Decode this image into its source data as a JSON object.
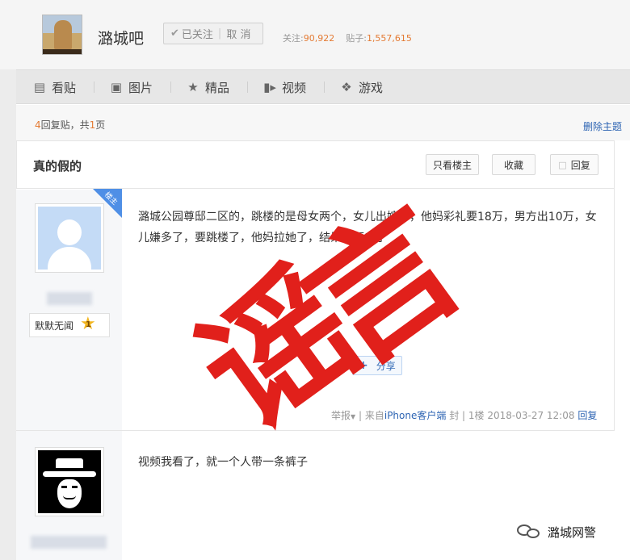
{
  "forum": {
    "name": "潞城吧",
    "followed_label": "已关注",
    "unfollow_label": "取 消",
    "stats": {
      "followers_label": "关注:",
      "followers": "90,922",
      "posts_label": "贴子:",
      "posts": "1,557,615"
    }
  },
  "nav": {
    "items": [
      {
        "label": "看贴",
        "icon": "document-icon"
      },
      {
        "label": "图片",
        "icon": "image-icon"
      },
      {
        "label": "精品",
        "icon": "star-icon"
      },
      {
        "label": "视频",
        "icon": "video-icon"
      },
      {
        "label": "游戏",
        "icon": "gamepad-icon"
      }
    ]
  },
  "reply_bar": {
    "count": "4",
    "text_mid": "回复贴，共",
    "pages": "1",
    "text_end": "页",
    "delete_topic": "删除主题"
  },
  "thread": {
    "title": "真的假的",
    "only_owner": "只看楼主",
    "favorite": "收藏",
    "reply": "回复"
  },
  "posts": [
    {
      "owner_badge": "楼主",
      "username_level": "默默无闻",
      "level": "1",
      "content": "潞城公园尊邸二区的，跳楼的是母女两个，女儿出嫁了，他妈彩礼要18万，男方出10万，女儿嫌多了，要跳楼了，他妈拉她了，结果都下去了",
      "share": "分享",
      "report": "举报",
      "source": "来自iPhone客户端",
      "seal": "封",
      "floor": "1楼",
      "time": "2018-03-27 12:08",
      "reply": "回复"
    },
    {
      "content": "视频我看了，就一个人带一条裤子"
    }
  ],
  "stamp": {
    "char1": "谣",
    "char2": "言",
    "color": "#e1201b"
  },
  "watermark": {
    "text": "潞城网警"
  },
  "colors": {
    "accent_orange": "#e47b34",
    "link_blue": "#2d64b3",
    "owner_badge_blue": "#4f8fe6"
  }
}
